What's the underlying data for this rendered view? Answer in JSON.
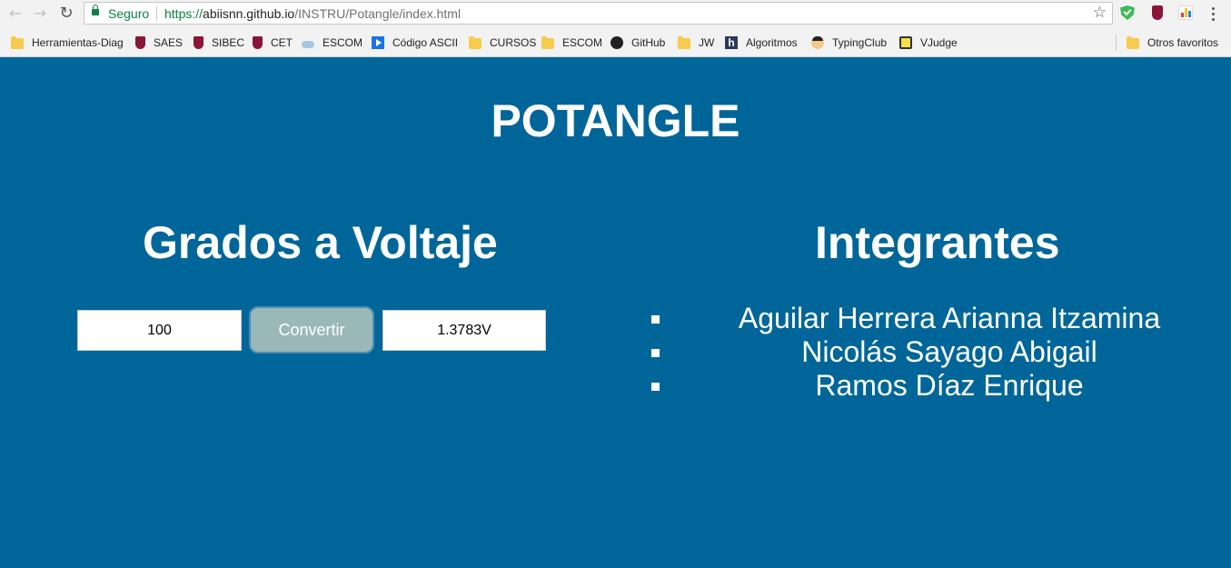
{
  "browser": {
    "secure_label": "Seguro",
    "url_scheme": "https://",
    "url_host": "abiisnn.github.io",
    "url_path": "/INSTRU/Potangle/index.html",
    "bookmarks": [
      {
        "label": "Herramientas-Diag",
        "icon": "folder-icon"
      },
      {
        "label": "SAES",
        "icon": "crest-icon"
      },
      {
        "label": "SIBEC",
        "icon": "crest-icon"
      },
      {
        "label": "CET",
        "icon": "crest-icon"
      },
      {
        "label": "ESCOM",
        "icon": "cloud-icon"
      },
      {
        "label": "Código ASCII",
        "icon": "play-icon"
      },
      {
        "label": "CURSOS",
        "icon": "folder-icon"
      },
      {
        "label": "ESCOM",
        "icon": "folder-icon"
      },
      {
        "label": "GitHub",
        "icon": "github-icon"
      },
      {
        "label": "JW",
        "icon": "folder-icon"
      },
      {
        "label": "Algoritmos",
        "icon": "h-square-icon"
      },
      {
        "label": "TypingClub",
        "icon": "face-icon"
      },
      {
        "label": "VJudge",
        "icon": "vjudge-icon"
      }
    ],
    "other_bookmarks": "Otros favoritos"
  },
  "page": {
    "title": "POTANGLE",
    "background_color": "#006699",
    "converter": {
      "title": "Grados a Voltaje",
      "input_value": "100",
      "button_label": "Convertir",
      "output_value": "1.3783V"
    },
    "team": {
      "title": "Integrantes",
      "members": [
        "Aguilar Herrera Arianna Itzamina",
        "Nicolás Sayago Abigail",
        "Ramos Díaz Enrique"
      ]
    }
  }
}
